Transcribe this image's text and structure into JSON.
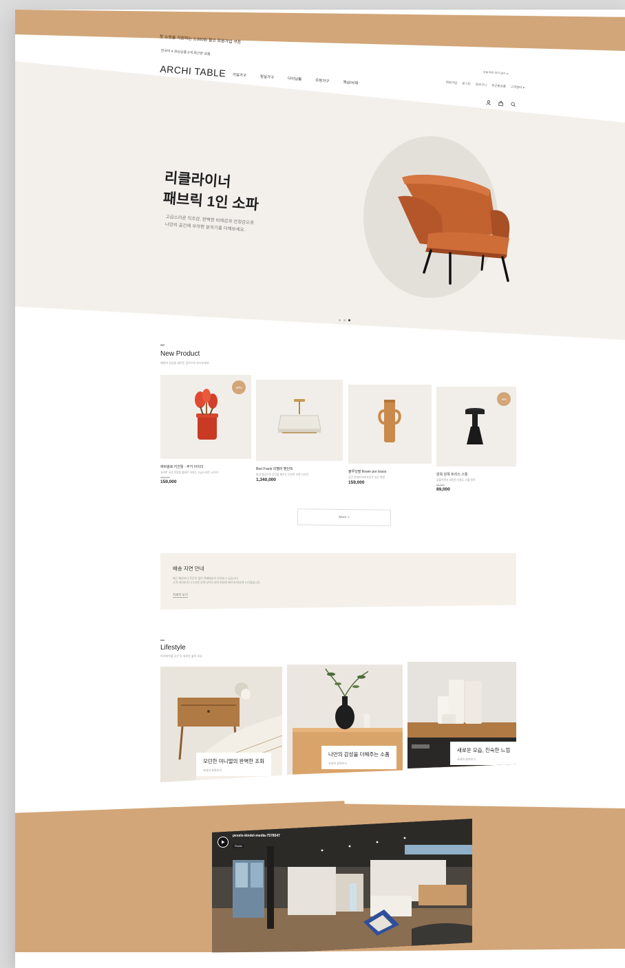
{
  "topbar": {
    "text": "첫 쇼핑을 지원하는 3,000원 할인 회원가입 쿠폰"
  },
  "header": {
    "language": "한국어 ▾   관심상품 0개  최근본 상품",
    "logo": "ARCHI TABLE",
    "nav": [
      "거실가구",
      "침실가구",
      "다이닝룸",
      "주방가구",
      "책상/서재"
    ],
    "notice": "오늘 하루 보지 않기  ✕",
    "util": [
      "회원가입",
      "로그인",
      "장바구니",
      "최근본상품",
      "고객센터 ▾"
    ],
    "icons": [
      "user-icon",
      "bag-icon",
      "search-icon"
    ]
  },
  "hero": {
    "title_line1": "리클라이너",
    "title_line2": "패브릭 1인 소파",
    "sub_line1": "고급스러운 직조감, 완벽한 비례감과 안정감으로",
    "sub_line2": "나만의 공간에 우아한 분위기를 더해보세요.",
    "slide_count": 3,
    "active_slide": 3
  },
  "new_product": {
    "title": "New Product",
    "subtitle": "매일의 일상을 새로운 감각으로 만나보세요",
    "items": [
      {
        "name": "에버솔로 키친툴 - 주거 아이더",
        "desc": "유려한 곡선 주방용 툴세트 더하는 고급스러운 10가지",
        "old_price": "199,000",
        "price": "159,000",
        "badge": "20%"
      },
      {
        "name": "Bert Frank 리펠러 펜던트",
        "desc": "빛과 질감으로 공간을 채우는 은은한 조명 디자인",
        "old_price": "",
        "price": "1,340,000",
        "badge": ""
      },
      {
        "name": "블루잉펄 flower por brass",
        "desc": "공간 인테리어에 포인트 되는 화병",
        "old_price": "",
        "price": "159,000",
        "badge": ""
      },
      {
        "name": "원목 원목 트리스 스툴",
        "desc": "심플하면서 세련된 다용도 스툴 원목",
        "old_price": "95,000",
        "price": "89,000",
        "badge": "-6%"
      }
    ],
    "more_label": "More +"
  },
  "delivery": {
    "title": "배송 지연 안내",
    "line1": "최근 예상보다 주문이 많아 택배배송이 지연되고 있습니다.",
    "line2": "고객 여러분의 너그러운 양해 부탁드리며 최대한 빠르게 배송해 드리겠습니다.",
    "link": "자세히 보기"
  },
  "lifestyle": {
    "title": "Lifestyle",
    "subtitle": "아키테이블 공간 속 새로운 삶의 모습",
    "cards": [
      {
        "headline": "모던한 미니멀의 완벽한 조화",
        "link": "자세히 살펴보기"
      },
      {
        "headline": "나만의 감성을 더해주는 소품",
        "link": "자세히 살펴보기"
      },
      {
        "headline": "새로운 모습, 친숙한 느낌",
        "link": "자세히 살펴보기"
      }
    ]
  },
  "video": {
    "title": "pexels-kindel-media-7578547",
    "source": "Pexels"
  },
  "colors": {
    "accent": "#d2a679",
    "hero_bg": "#f3f0eb",
    "chair": "#c1622f"
  }
}
